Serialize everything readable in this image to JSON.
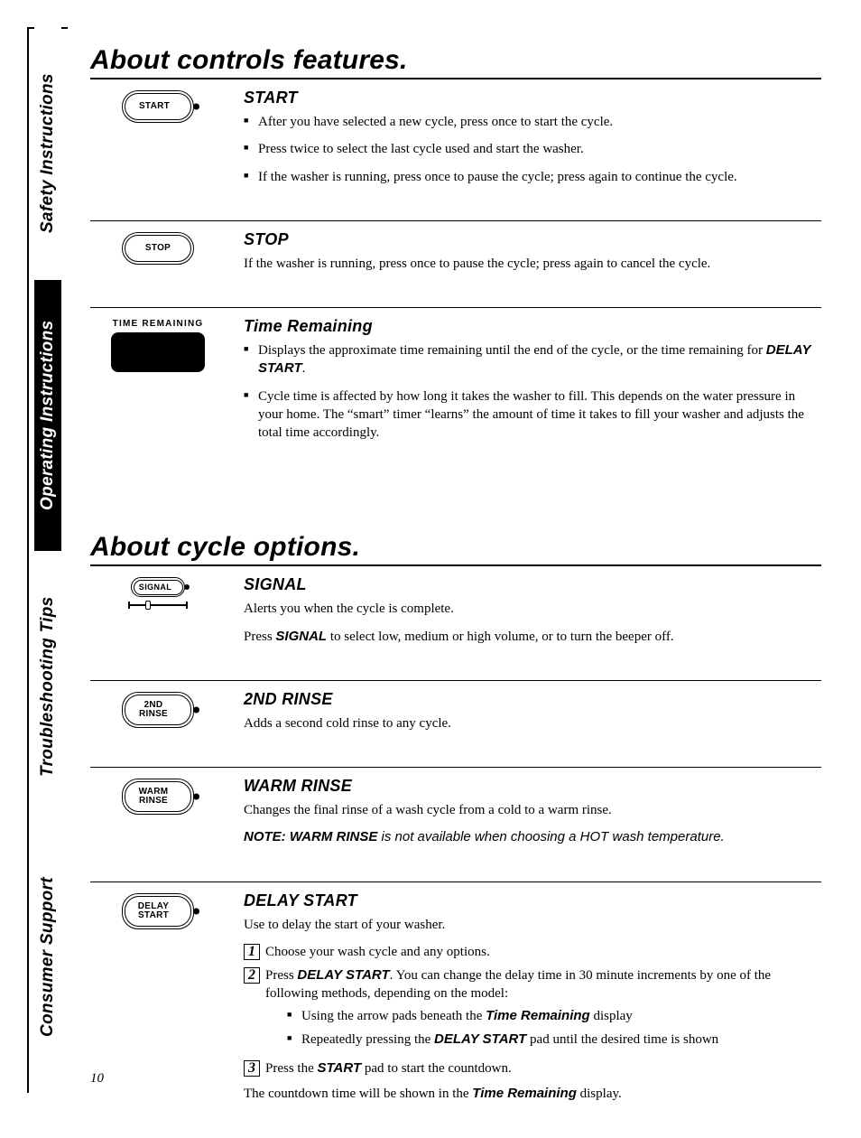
{
  "side_tabs": {
    "safety": "Safety Instructions",
    "operating": "Operating Instructions",
    "trouble": "Troubleshooting Tips",
    "consumer": "Consumer Support"
  },
  "h1_controls": "About controls features.",
  "start": {
    "btn": "START",
    "title": "START",
    "b1": "After you have selected a new cycle, press once to start the cycle.",
    "b2": "Press twice to select the last cycle used and start the washer.",
    "b3": "If the washer is running, press once to pause the cycle; press again to continue the cycle."
  },
  "stop": {
    "btn": "STOP",
    "title": "STOP",
    "p": "If the washer is running, press once to pause the cycle; press again to cancel the cycle."
  },
  "time": {
    "icon_label": "TIME  REMAINING",
    "title": "Time Remaining",
    "b1a": "Displays the approximate time remaining until the end of the cycle, or the time remaining for ",
    "b1b": "DELAY START",
    "b1c": ".",
    "b2": "Cycle time is affected by how long it takes the washer to fill. This depends on the water pressure in your home. The “smart” timer “learns” the amount of time it takes to fill your washer and adjusts the total time accordingly."
  },
  "h1_cycle": "About cycle options.",
  "signal": {
    "btn": "SIGNAL",
    "title": "SIGNAL",
    "p1": "Alerts you when the cycle is complete.",
    "p2a": "Press ",
    "p2b": "SIGNAL",
    "p2c": " to select low, medium or high volume, or to turn the beeper off."
  },
  "rinse2": {
    "btn_l1": "2ND",
    "btn_l2": "RINSE",
    "title": "2ND RINSE",
    "p": "Adds a second cold rinse to any cycle."
  },
  "warm": {
    "btn_l1": "WARM",
    "btn_l2": "RINSE",
    "title": "WARM RINSE",
    "p": "Changes the final rinse of a wash cycle from a cold to a warm rinse.",
    "note_a": "NOTE: WARM RINSE",
    "note_b": " is not available when choosing a HOT wash temperature."
  },
  "delay": {
    "btn_l1": "DELAY",
    "btn_l2": "START",
    "title": "DELAY START",
    "p": "Use to delay the start of your washer.",
    "s1": "Choose your wash cycle and any options.",
    "s2a": "Press ",
    "s2b": "DELAY START",
    "s2c": ". You can change the delay time in 30 minute increments by one of the following methods, depending on the model:",
    "s2_b1a": "Using the arrow pads beneath the ",
    "s2_b1b": "Time Remaining",
    "s2_b1c": " display",
    "s2_b2a": "Repeatedly pressing the ",
    "s2_b2b": "DELAY START",
    "s2_b2c": " pad until the desired time is shown",
    "s3a": "Press the ",
    "s3b": "START",
    "s3c": " pad to start the countdown.",
    "tail_a": "The countdown time will be shown in the ",
    "tail_b": "Time Remaining",
    "tail_c": " display."
  },
  "nums": {
    "n1": "1",
    "n2": "2",
    "n3": "3"
  },
  "page_number": "10"
}
